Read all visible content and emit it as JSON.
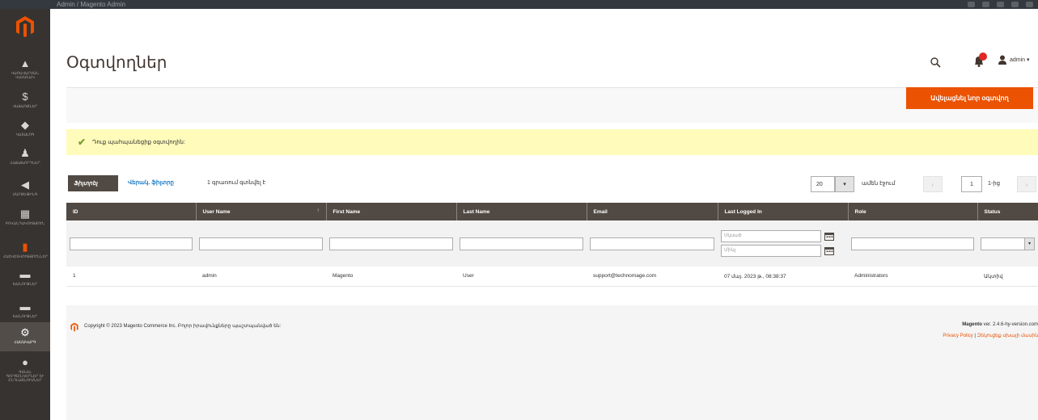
{
  "browser": {
    "title": "Admin / Magento Admin"
  },
  "sidebar": {
    "items": [
      {
        "icon": "dashboard-icon",
        "glyph": "▲",
        "label": "Կառավարման վահանակ"
      },
      {
        "icon": "dollar-icon",
        "glyph": "$",
        "label": "Վաճառքներ"
      },
      {
        "icon": "cube-icon",
        "glyph": "◆",
        "label": "Կատալոգ"
      },
      {
        "icon": "person-icon",
        "glyph": "♟",
        "label": "Հաճախորդներ"
      },
      {
        "icon": "megaphone-icon",
        "glyph": "◀",
        "label": "Մարքեթինգ"
      },
      {
        "icon": "layout-icon",
        "glyph": "▦",
        "label": "Բովանդակություն"
      },
      {
        "icon": "bars-icon",
        "glyph": "▮",
        "label": "Հաշվետվություններ"
      },
      {
        "icon": "store-icon",
        "glyph": "▬",
        "label": "Խանութներ"
      },
      {
        "icon": "gear-icon",
        "glyph": "⚙",
        "label": "Համակարգ"
      },
      {
        "icon": "puzzle-icon",
        "glyph": "●",
        "label": "Գտնել գործընկերներ և ընդլայնումներ"
      }
    ]
  },
  "header": {
    "title": "Օգտվողներ",
    "user": "admin ▾"
  },
  "actions": {
    "add_label": "Ավելացնել նոր օգտվող"
  },
  "message": {
    "text": "Դուք պահպանեցիք օգտվողին:"
  },
  "toolbar": {
    "filters_label": "Ֆիլտրել",
    "reset_label": "Վերակ. ֆիլտրը",
    "records": "1 գրառում գտնվել է",
    "per_page": "20",
    "per_page_label": "ամեն էջում",
    "page": "1",
    "page_of": "1-ից"
  },
  "grid": {
    "columns": [
      "ID",
      "User Name",
      "First Name",
      "Last Name",
      "Email",
      "Last Logged In",
      "Role",
      "Status"
    ],
    "date_from_placeholder": "Սկսած",
    "date_to_placeholder": "Մինչ",
    "rows": [
      {
        "id": "1",
        "username": "admin",
        "firstname": "Magento",
        "lastname": "User",
        "email": "support@technomage.com",
        "last_logged": "07 մայ. 2023 թ., 08:38:37",
        "role": "Administrators",
        "status": "Ակտիվ"
      }
    ]
  },
  "footer": {
    "copyright": "Copyright © 2023 Magento Commerce Inc. Բոլոր իրավունքները պաշտպանված են:",
    "version_brand": "Magento",
    "version_text": " ver. 2.4.6-hy-version.com",
    "privacy": "Privacy Policy",
    "separator": " | ",
    "report": "Զեկուցեք սխալի մասին"
  }
}
